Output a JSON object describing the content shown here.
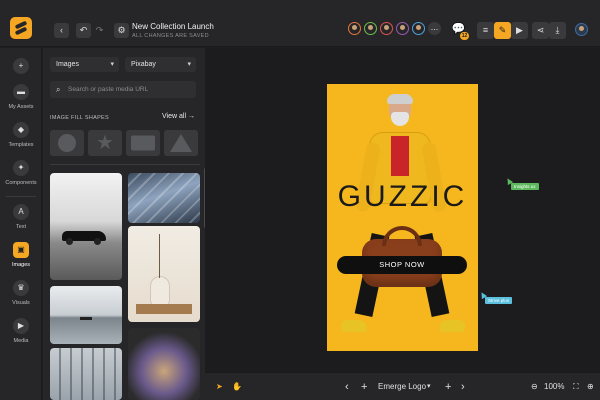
{
  "header": {
    "back_icon": "chevron-left-icon",
    "undo_icon": "undo-icon",
    "redo_icon": "redo-icon",
    "settings_icon": "gear-icon",
    "title": "New Collection Launch",
    "save_status": "ALL CHANGES ARE SAVED",
    "collaborators": [
      {
        "color": "#e8743b"
      },
      {
        "color": "#6abf4b"
      },
      {
        "color": "#e05252"
      },
      {
        "color": "#9b59b6"
      },
      {
        "color": "#4aa3df"
      }
    ],
    "more_label": "...",
    "comments_count": "12",
    "toolbar": {
      "grid_icon": "grid-icon",
      "edit_icon": "pencil-icon",
      "play_icon": "play-icon",
      "share_icon": "share-icon",
      "download_icon": "download-icon",
      "account_icon": "user-avatar"
    }
  },
  "rail": {
    "items": [
      {
        "label": "My Assets",
        "icon": "folder-icon",
        "glyph": "▬"
      },
      {
        "label": "Templates",
        "icon": "droplet-icon",
        "glyph": "◆"
      },
      {
        "label": "Components",
        "icon": "components-icon",
        "glyph": "✦"
      },
      {
        "label": "Text",
        "icon": "text-icon",
        "glyph": "A"
      },
      {
        "label": "Images",
        "icon": "image-icon",
        "glyph": "▣"
      },
      {
        "label": "Visuals",
        "icon": "crown-icon",
        "glyph": "♛"
      },
      {
        "label": "Media",
        "icon": "play-icon",
        "glyph": "▶"
      }
    ],
    "add_glyph": "+",
    "active": "Images"
  },
  "panel": {
    "type_select": "Images",
    "source_select": "Pixabay",
    "search_placeholder": "Search or paste media URL",
    "section_title": "IMAGE FILL SHAPES",
    "view_all": "View all",
    "shapes": [
      "circle",
      "star",
      "rectangle",
      "triangle"
    ]
  },
  "canvas": {
    "brand": "GUZZIC",
    "cta": "SHOP NOW",
    "cursors": [
      {
        "label": "Insights ux",
        "color": "#5cb85c"
      },
      {
        "label": "Strive plus",
        "color": "#5bc0de"
      }
    ]
  },
  "footer": {
    "page_name": "Emerge Logo",
    "zoom": "100%"
  },
  "colors": {
    "accent": "#f5a623",
    "artboard_bg": "#f5b61e"
  }
}
